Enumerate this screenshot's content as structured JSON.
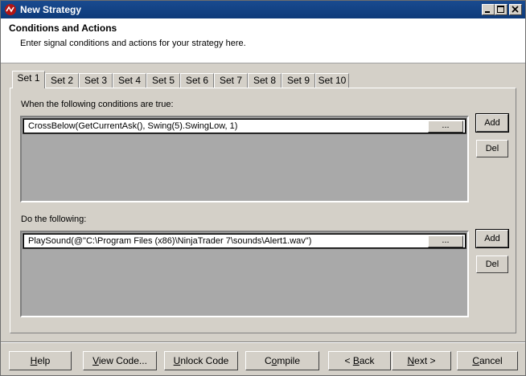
{
  "window": {
    "title": "New Strategy",
    "caption_buttons": [
      "minimize-icon",
      "maximize-icon",
      "close-icon"
    ]
  },
  "header": {
    "title": "Conditions and Actions",
    "subtitle": "Enter signal conditions and actions for your strategy here."
  },
  "tabs": [
    {
      "label": "Set 1",
      "active": true
    },
    {
      "label": "Set 2"
    },
    {
      "label": "Set 3"
    },
    {
      "label": "Set 4"
    },
    {
      "label": "Set 5"
    },
    {
      "label": "Set 6"
    },
    {
      "label": "Set 7"
    },
    {
      "label": "Set 8"
    },
    {
      "label": "Set 9"
    },
    {
      "label": "Set 10"
    }
  ],
  "conditions": {
    "label": "When the following conditions are true:",
    "items": [
      {
        "text": "CrossBelow(GetCurrentAsk(), Swing(5).SwingLow, 1)",
        "button": "..."
      }
    ],
    "add_label": "Add",
    "del_label": "Del"
  },
  "actions": {
    "label": "Do the following:",
    "items": [
      {
        "text": "PlaySound(@\"C:\\Program Files (x86)\\NinjaTrader 7\\sounds\\Alert1.wav\")",
        "button": "..."
      }
    ],
    "add_label": "Add",
    "del_label": "Del"
  },
  "footer": {
    "help": {
      "pre": "",
      "u": "H",
      "post": "elp"
    },
    "view_code": {
      "pre": "",
      "u": "V",
      "post": "iew Code..."
    },
    "unlock_code": {
      "pre": "",
      "u": "U",
      "post": "nlock Code"
    },
    "compile": {
      "pre": "C",
      "u": "o",
      "post": "mpile"
    },
    "back": {
      "pre": "< ",
      "u": "B",
      "post": "ack"
    },
    "next": {
      "pre": "",
      "u": "N",
      "post": "ext >"
    },
    "cancel": {
      "pre": "",
      "u": "C",
      "post": "ancel"
    }
  }
}
